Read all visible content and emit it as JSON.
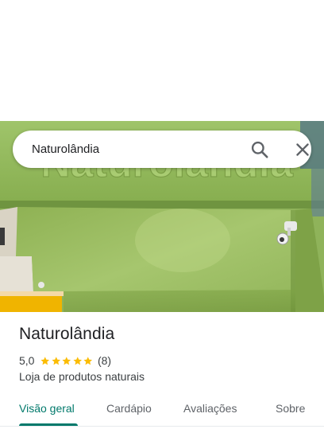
{
  "search": {
    "value": "Naturolândia",
    "search_icon": "search-icon",
    "close_icon": "close-icon"
  },
  "hero": {
    "sign_text": "Naturolândia"
  },
  "place": {
    "name": "Naturolândia",
    "rating": "5,0",
    "stars": 5,
    "review_count": "(8)",
    "category": "Loja de produtos naturais"
  },
  "tabs": [
    {
      "label": "Visão geral",
      "active": true
    },
    {
      "label": "Cardápio",
      "active": false
    },
    {
      "label": "Avaliações",
      "active": false
    },
    {
      "label": "Sobre",
      "active": false
    }
  ],
  "colors": {
    "accent": "#00796b",
    "star": "#fbbc04",
    "facade_green": "#8fb35a"
  }
}
